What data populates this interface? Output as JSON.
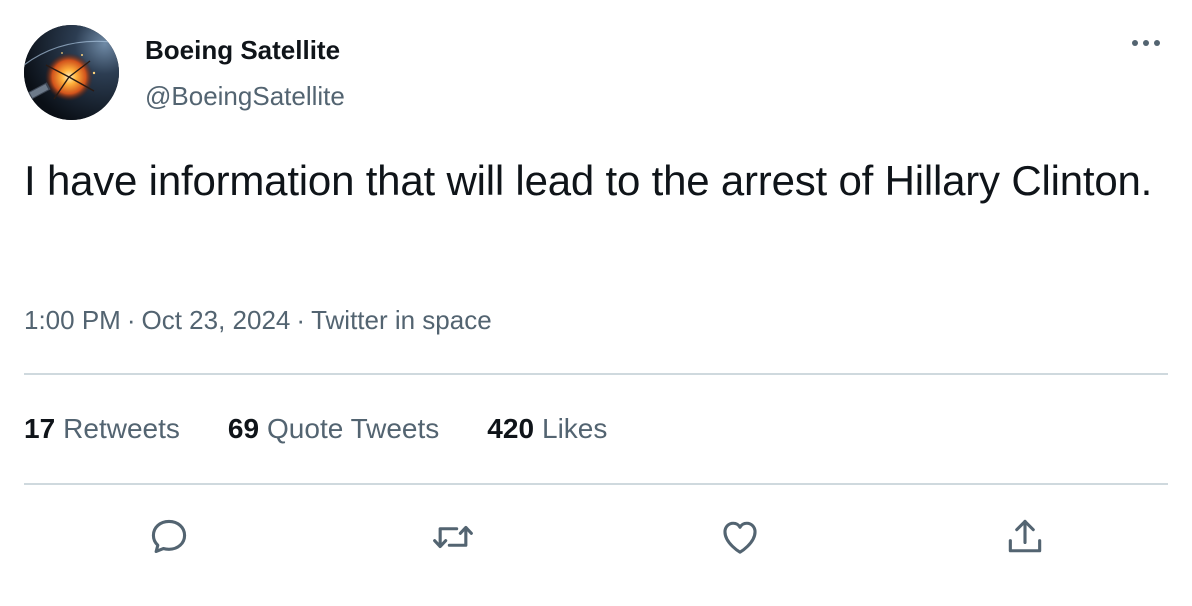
{
  "author": {
    "display_name": "Boeing Satellite",
    "handle": "@BoeingSatellite",
    "avatar_icon": "satellite-explosion-avatar"
  },
  "tweet": {
    "text": "I have information that will lead to the arrest of Hillary Clinton.",
    "time": "1:00 PM",
    "date": "Oct 23, 2024",
    "source": "Twitter in space",
    "separator": "·"
  },
  "stats": {
    "retweets_count": "17",
    "retweets_label": "Retweets",
    "quotes_count": "69",
    "quotes_label": "Quote Tweets",
    "likes_count": "420",
    "likes_label": "Likes"
  },
  "actions": {
    "reply_icon": "reply-icon",
    "retweet_icon": "retweet-icon",
    "like_icon": "heart-icon",
    "share_icon": "share-icon"
  },
  "colors": {
    "text_primary": "#0f1419",
    "text_secondary": "#536471",
    "divider": "#cfd9de"
  }
}
